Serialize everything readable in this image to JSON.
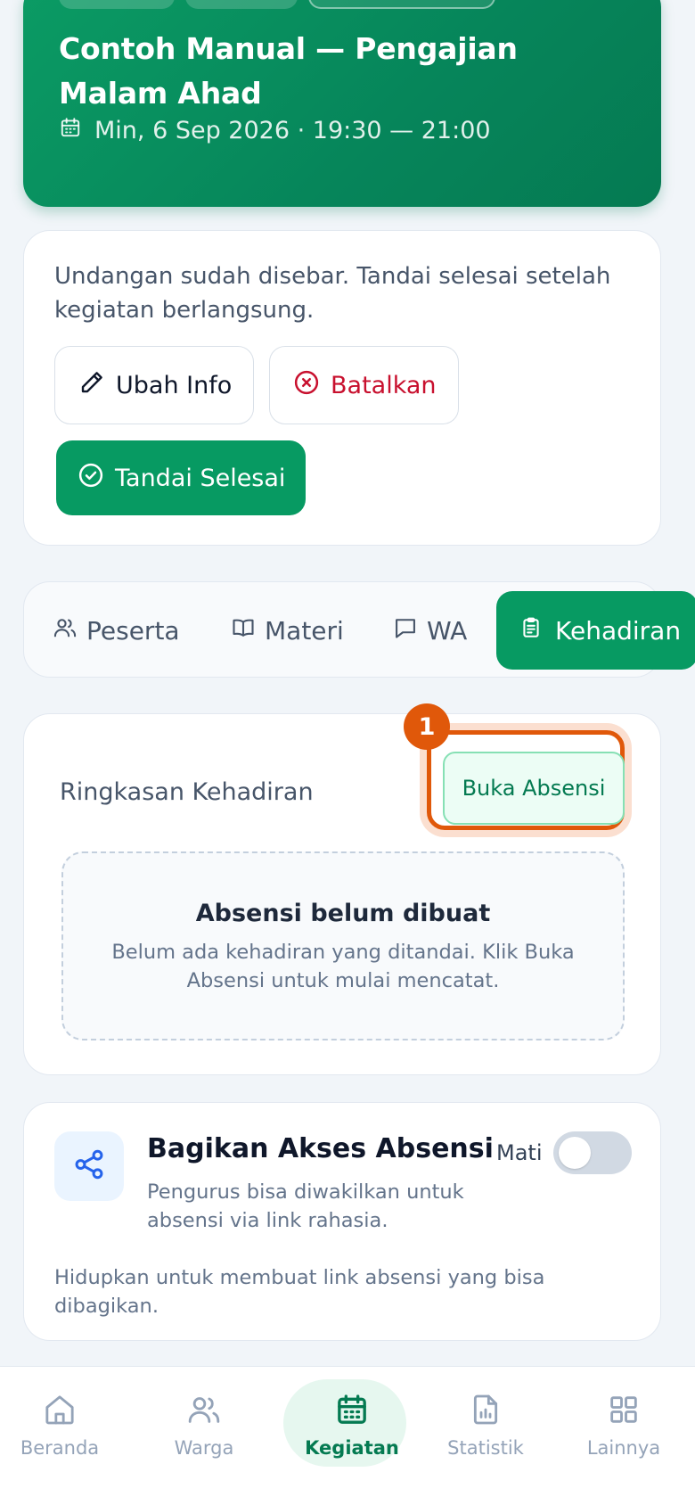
{
  "hero": {
    "title": "Contoh Manual — Pengajian Malam Ahad",
    "datetime": "Min, 6 Sep 2026 · 19:30 — 21:00"
  },
  "status": {
    "message": "Undangan sudah disebar. Tandai selesai setelah kegiatan berlangsung.",
    "edit_label": "Ubah Info",
    "cancel_label": "Batalkan",
    "done_label": "Tandai Selesai"
  },
  "tabs": [
    {
      "label": "Peserta",
      "icon": "users-icon"
    },
    {
      "label": "Materi",
      "icon": "book-icon"
    },
    {
      "label": "WA",
      "icon": "chat-icon"
    },
    {
      "label": "Kehadiran",
      "icon": "clipboard-icon",
      "active": true
    }
  ],
  "attendance": {
    "title": "Ringkasan Kehadiran",
    "step_badge": "1",
    "open_button": "Buka Absensi",
    "empty_title": "Absensi belum dibuat",
    "empty_desc": "Belum ada kehadiran yang ditandai. Klik Buka Absensi untuk mulai mencatat."
  },
  "share": {
    "title": "Bagikan Akses Absensi",
    "subtitle": "Pengurus bisa diwakilkan untuk absensi via link rahasia.",
    "toggle_label": "Mati",
    "toggle_on": false,
    "footer": "Hidupkan untuk membuat link absensi yang bisa dibagikan."
  },
  "nav": [
    {
      "label": "Beranda",
      "icon": "home-icon"
    },
    {
      "label": "Warga",
      "icon": "people-icon"
    },
    {
      "label": "Kegiatan",
      "icon": "calendar-icon",
      "active": true
    },
    {
      "label": "Statistik",
      "icon": "report-icon"
    },
    {
      "label": "Lainnya",
      "icon": "grid-icon"
    }
  ],
  "colors": {
    "primary": "#079a62",
    "danger": "#c8102e",
    "highlight": "#e0580a"
  }
}
